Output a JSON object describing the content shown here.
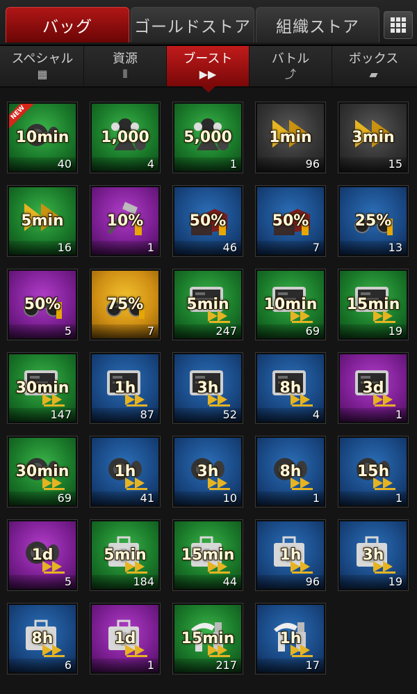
{
  "main_tabs": [
    {
      "label": "バッグ",
      "active": true
    },
    {
      "label": "ゴールドストア",
      "active": false
    },
    {
      "label": "組織ストア",
      "active": false
    }
  ],
  "sub_tabs": [
    {
      "label": "スペシャル",
      "icon": "grid-icon",
      "active": false
    },
    {
      "label": "資源",
      "icon": "ammo-icon",
      "active": false
    },
    {
      "label": "ブースト",
      "icon": "fast-forward-icon",
      "active": true
    },
    {
      "label": "バトル",
      "icon": "arrow-up-icon",
      "active": false
    },
    {
      "label": "ボックス",
      "icon": "box-icon",
      "active": false
    }
  ],
  "new_badge": "NEW",
  "items": [
    {
      "label": "10min",
      "count": "40",
      "bg": "green",
      "icon": "dumbbell-icon",
      "arrows": false,
      "new": true
    },
    {
      "label": "1,000",
      "count": "4",
      "bg": "green",
      "icon": "gangster-icon",
      "arrows": false
    },
    {
      "label": "5,000",
      "count": "1",
      "bg": "green",
      "icon": "gangster-icon",
      "arrows": false
    },
    {
      "label": "1min",
      "count": "96",
      "bg": "gray",
      "icon": "fast-forward-icon",
      "arrows": false
    },
    {
      "label": "3min",
      "count": "15",
      "bg": "gray",
      "icon": "fast-forward-icon",
      "arrows": false
    },
    {
      "label": "5min",
      "count": "16",
      "bg": "green",
      "icon": "fast-forward-icon",
      "arrows": false
    },
    {
      "label": "10%",
      "count": "1",
      "bg": "purple",
      "icon": "hammer-icon",
      "arrows": false
    },
    {
      "label": "50%",
      "count": "46",
      "bg": "blue",
      "icon": "building-icon",
      "arrows": false
    },
    {
      "label": "50%",
      "count": "7",
      "bg": "blue",
      "icon": "building-icon",
      "arrows": false
    },
    {
      "label": "25%",
      "count": "13",
      "bg": "blue",
      "icon": "motorcycle-icon",
      "arrows": false
    },
    {
      "label": "50%",
      "count": "5",
      "bg": "purple",
      "icon": "motorcycle-icon",
      "arrows": false
    },
    {
      "label": "75%",
      "count": "7",
      "bg": "gold",
      "icon": "motorcycle-icon",
      "arrows": false
    },
    {
      "label": "5min",
      "count": "247",
      "bg": "green",
      "icon": "tablet-icon",
      "arrows": true
    },
    {
      "label": "10min",
      "count": "69",
      "bg": "green",
      "icon": "tablet-icon",
      "arrows": true
    },
    {
      "label": "15min",
      "count": "19",
      "bg": "green",
      "icon": "tablet-icon",
      "arrows": true
    },
    {
      "label": "30min",
      "count": "147",
      "bg": "green",
      "icon": "tablet-icon",
      "arrows": true
    },
    {
      "label": "1h",
      "count": "87",
      "bg": "blue",
      "icon": "tablet-icon",
      "arrows": true
    },
    {
      "label": "3h",
      "count": "52",
      "bg": "blue",
      "icon": "tablet-icon",
      "arrows": true
    },
    {
      "label": "8h",
      "count": "4",
      "bg": "blue",
      "icon": "tablet-icon",
      "arrows": true
    },
    {
      "label": "3d",
      "count": "1",
      "bg": "purple",
      "icon": "tablet-icon",
      "arrows": true
    },
    {
      "label": "30min",
      "count": "69",
      "bg": "green",
      "icon": "dumbbell-icon",
      "arrows": true
    },
    {
      "label": "1h",
      "count": "41",
      "bg": "blue",
      "icon": "dumbbell-icon",
      "arrows": true
    },
    {
      "label": "3h",
      "count": "10",
      "bg": "blue",
      "icon": "dumbbell-icon",
      "arrows": true
    },
    {
      "label": "8h",
      "count": "1",
      "bg": "blue",
      "icon": "dumbbell-icon",
      "arrows": true
    },
    {
      "label": "15h",
      "count": "1",
      "bg": "blue",
      "icon": "dumbbell-icon",
      "arrows": true
    },
    {
      "label": "1d",
      "count": "5",
      "bg": "purple",
      "icon": "dumbbell-icon",
      "arrows": true
    },
    {
      "label": "5min",
      "count": "184",
      "bg": "green",
      "icon": "medkit-icon",
      "arrows": true
    },
    {
      "label": "15min",
      "count": "44",
      "bg": "green",
      "icon": "medkit-icon",
      "arrows": true
    },
    {
      "label": "1h",
      "count": "96",
      "bg": "blue",
      "icon": "medkit-icon",
      "arrows": true
    },
    {
      "label": "3h",
      "count": "19",
      "bg": "blue",
      "icon": "medkit-icon",
      "arrows": true
    },
    {
      "label": "8h",
      "count": "6",
      "bg": "blue",
      "icon": "medkit-icon",
      "arrows": true
    },
    {
      "label": "1d",
      "count": "1",
      "bg": "purple",
      "icon": "medkit-icon",
      "arrows": true
    },
    {
      "label": "15min",
      "count": "217",
      "bg": "green",
      "icon": "lamp-icon",
      "arrows": true
    },
    {
      "label": "1h",
      "count": "17",
      "bg": "blue",
      "icon": "lamp-icon",
      "arrows": true
    }
  ],
  "colors": {
    "active_tab": "#b01616",
    "label_text": "#fff8dc",
    "arrow": "#e6b422"
  }
}
